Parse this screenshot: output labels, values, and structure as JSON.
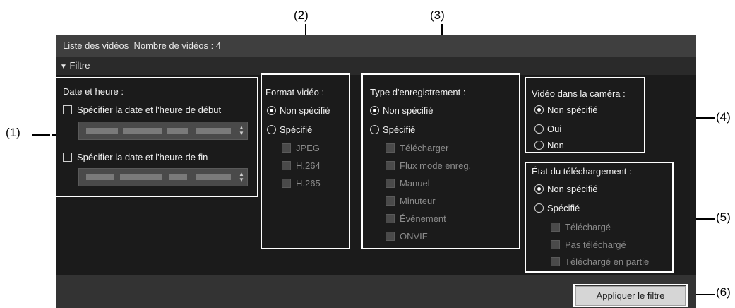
{
  "header": {
    "list_title": "Liste des vidéos",
    "video_count": "Nombre de vidéos : 4"
  },
  "filter": {
    "toggle_icon": "▼",
    "label": "Filtre"
  },
  "date_time": {
    "title": "Date et heure :",
    "start_label": "Spécifier la date et l'heure de début",
    "end_label": "Spécifier la date et l'heure de fin"
  },
  "video_format": {
    "title": "Format vidéo :",
    "opt_unspecified": "Non spécifié",
    "opt_specified": "Spécifié",
    "items": [
      "JPEG",
      "H.264",
      "H.265"
    ]
  },
  "recording_type": {
    "title": "Type d'enregistrement :",
    "opt_unspecified": "Non spécifié",
    "opt_specified": "Spécifié",
    "items": [
      "Télécharger",
      "Flux mode enreg.",
      "Manuel",
      "Minuteur",
      "Événement",
      "ONVIF"
    ]
  },
  "video_in_camera": {
    "title": "Vidéo dans la caméra :",
    "options": [
      "Non spécifié",
      "Oui",
      "Non"
    ]
  },
  "download_state": {
    "title": "État du téléchargement :",
    "opt_unspecified": "Non spécifié",
    "opt_specified": "Spécifié",
    "items": [
      "Téléchargé",
      "Pas téléchargé",
      "Téléchargé en partie"
    ]
  },
  "apply_label": "Appliquer le filtre",
  "callouts": [
    "(1)",
    "(2)",
    "(3)",
    "(4)",
    "(5)",
    "(6)"
  ]
}
